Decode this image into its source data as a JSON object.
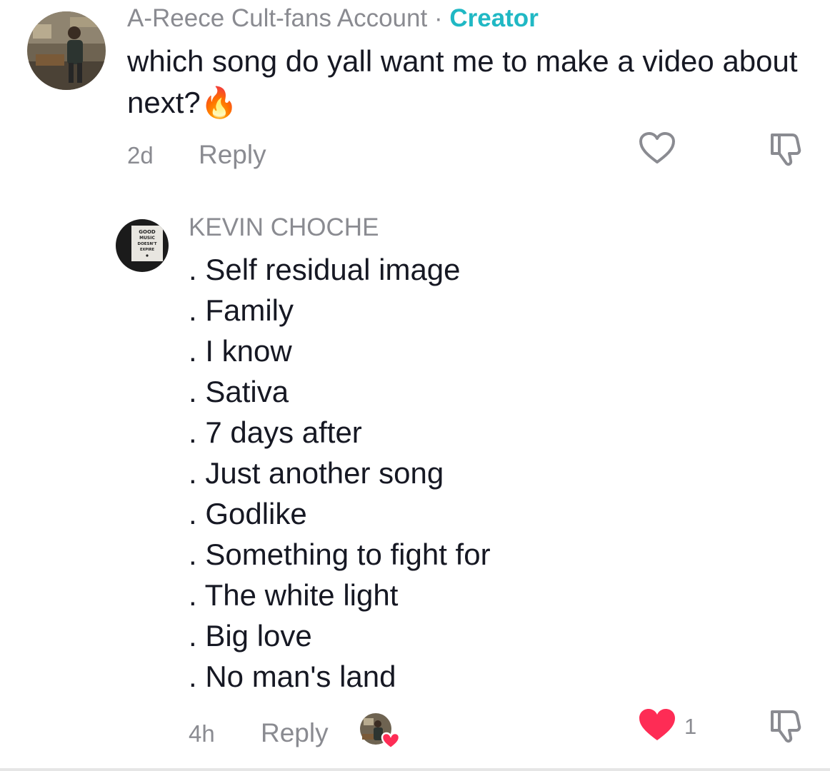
{
  "comment": {
    "username": "A-Reece Cult-fans Account",
    "separator": " · ",
    "badge": "Creator",
    "text": "which song do yall want me to make a video about next?🔥",
    "time": "2d",
    "reply_label": "Reply",
    "like_icon": "heart-outline-icon",
    "dislike_icon": "thumbs-down-icon"
  },
  "reply": {
    "username": "KEVIN CHOCHE",
    "avatar_text": [
      "GOOD",
      "MUSIC",
      "DOESN'T",
      "EXPIRE"
    ],
    "songs": [
      ". Self residual image",
      ". Family",
      ". I know",
      ". Sativa",
      ". 7 days after",
      ". Just another song",
      ". Godlike",
      ". Something to fight for",
      ". The white light",
      ". Big love",
      ". No man's land"
    ],
    "time": "4h",
    "reply_label": "Reply",
    "like_icon": "heart-filled-icon",
    "like_count": "1",
    "dislike_icon": "thumbs-down-icon",
    "liked_color": "#fe2c55"
  }
}
